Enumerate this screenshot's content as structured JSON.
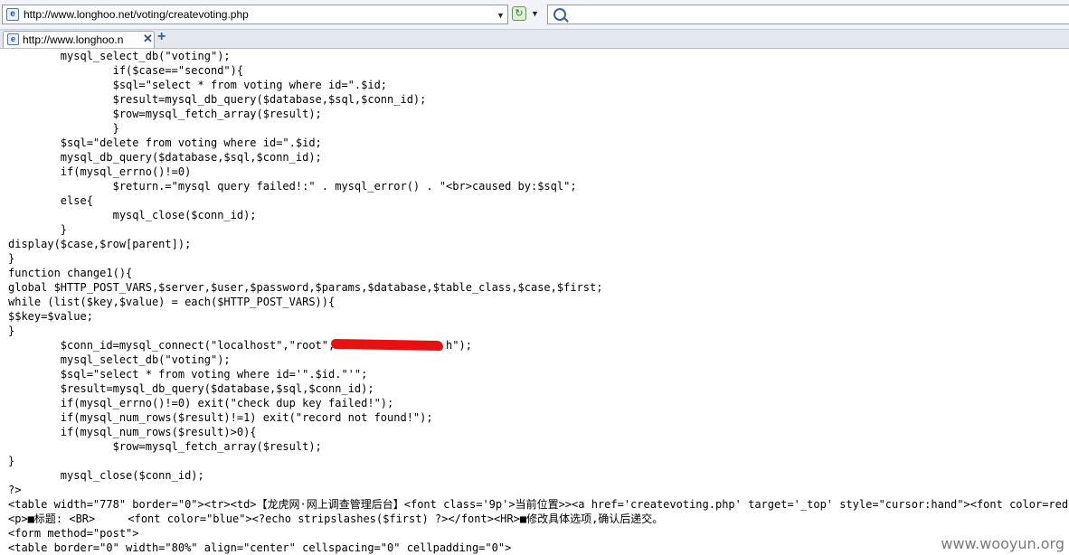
{
  "address_bar": {
    "url": "http://www.longhoo.net/voting/createvoting.php",
    "page_icon": "ie-page-icon",
    "dropdown_icon": "chevron-down-icon",
    "go_icon": "refresh-icon",
    "search_icon": "search-icon",
    "search_value": ""
  },
  "tabs": [
    {
      "label": "http://www.longhoo.n",
      "close_icon": "close-icon"
    }
  ],
  "new_tab_icon": "plus-icon",
  "source_lines": [
    "        mysql_select_db(\"voting\");",
    "                if($case==\"second\"){",
    "                $sql=\"select * from voting where id=\".$id;",
    "                $result=mysql_db_query($database,$sql,$conn_id);",
    "                $row=mysql_fetch_array($result);",
    "                }",
    "        $sql=\"delete from voting where id=\".$id;",
    "        mysql_db_query($database,$sql,$conn_id);",
    "        if(mysql_errno()!=0)",
    "                $return.=\"mysql query failed!:\" . mysql_error() . \"<br>caused by:$sql\";",
    "        else{",
    "                mysql_close($conn_id);",
    "        }",
    "display($case,$row[parent]);",
    "}",
    "function change1(){",
    "global $HTTP_POST_VARS,$server,$user,$password,$params,$database,$table_class,$case,$first;",
    "while (list($key,$value) = each($HTTP_POST_VARS)){",
    "$$key=$value;",
    "}",
    "        $conn_id=mysql_connect(\"localhost\",\"root\",\"                h\");",
    "        mysql_select_db(\"voting\");",
    "        $sql=\"select * from voting where id='\".$id.\"'\";",
    "        $result=mysql_db_query($database,$sql,$conn_id);",
    "        if(mysql_errno()!=0) exit(\"check dup key failed!\");",
    "        if(mysql_num_rows($result)!=1) exit(\"record not found!\");",
    "        if(mysql_num_rows($result)>0){",
    "                $row=mysql_fetch_array($result);",
    "}",
    "        mysql_close($conn_id);",
    "?>",
    "<table width=\"778\" border=\"0\"><tr><td>【龙虎网·网上调查管理后台】<font class='9p'>当前位置>><a href='createvoting.php' target='_top' style=\"cursor:hand\"><font color=red",
    "<p>■标题: <BR>     <font color=\"blue\"><?echo stripslashes($first) ?></font><HR>■修改具体选项,确认后递交。",
    "<form method=\"post\">",
    "<table border=\"0\" width=\"80%\" align=\"center\" cellspacing=\"0\" cellpadding=\"0\">"
  ],
  "watermark": "www.wooyun.org"
}
